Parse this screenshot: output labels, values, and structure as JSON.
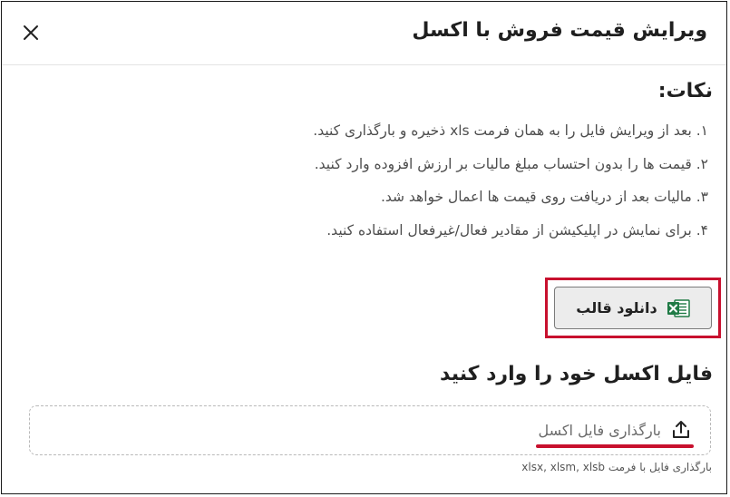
{
  "dialog": {
    "title": "ویرایش قیمت فروش با اکسل",
    "close_icon": "close-icon"
  },
  "notes": {
    "heading": "نکات:",
    "items": [
      "۱. بعد از ویرایش فایل را به همان فرمت xls ذخیره و بارگذاری کنید.",
      "۲. قیمت ها را بدون احتساب مبلغ مالیات بر ارزش افزوده وارد کنید.",
      "۳. مالیات بعد از دریافت روی قیمت ها اعمال خواهد شد.",
      "۴. برای نمایش در اپلیکیشن از مقادیر فعال/غیرفعال استفاده کنید."
    ]
  },
  "download": {
    "label": "دانلود قالب",
    "icon": "excel-icon"
  },
  "upload": {
    "heading": "فایل اکسل خود را وارد کنید",
    "dropzone_label": "بارگذاری فایل اکسل",
    "icon": "upload-icon",
    "format_hint": "بارگذاری فایل با فرمت xlsx, xlsm, xlsb"
  },
  "colors": {
    "annotation_red": "#c8102e",
    "excel_green": "#1f7a45"
  }
}
